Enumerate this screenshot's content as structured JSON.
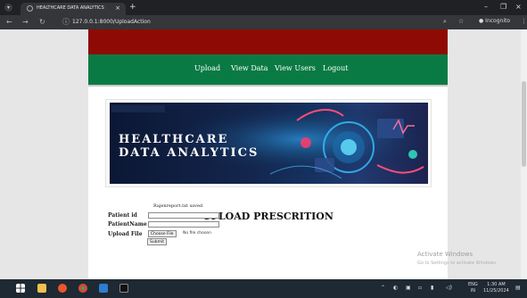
{
  "browser": {
    "tab_title": "HEALTHCARE DATA ANALYTICS",
    "url": "127.0.0.1:8000/UploadAction",
    "profile_label": "Incognito",
    "icons": {
      "tab_dropdown": "chevron-down-icon",
      "favicon": "globe-icon",
      "tab_close": "close-icon",
      "new_tab": "plus-icon",
      "minimize": "minimize-icon",
      "maximize": "maximize-icon",
      "close": "close-icon",
      "back": "back-arrow-icon",
      "forward": "forward-arrow-icon",
      "reload": "reload-icon",
      "site_info": "site-info-icon",
      "search": "search-icon",
      "bookmark": "star-icon",
      "menu": "kebab-menu-icon"
    }
  },
  "nav": {
    "links": [
      {
        "label": "Upload"
      },
      {
        "label": "View Data"
      },
      {
        "label": "View Users"
      },
      {
        "label": "Logout"
      }
    ]
  },
  "banner": {
    "line1": "HEALTHCARE",
    "line2": "DATA ANALYTICS"
  },
  "main": {
    "heading": "UPLOAD PRESCRITION",
    "status_message": "Rajenreport.txt saved",
    "form": {
      "patient_id_label": "Patient id",
      "patient_id_value": "",
      "patient_name_label": "PatientName",
      "patient_name_value": "",
      "upload_file_label": "Upload File",
      "choose_file_label": "Choose File",
      "no_file_text": "No file chosen",
      "submit_label": "Submit"
    }
  },
  "watermark": {
    "title": "Activate Windows",
    "subtitle": "Go to Settings to activate Windows."
  },
  "taskbar": {
    "lang_line1": "ENG",
    "lang_line2": "IN",
    "time": "1:30 AM",
    "date": "11/25/2024"
  },
  "colors": {
    "top_band": "#8e0b05",
    "nav_band": "#0a7a44",
    "browser_frame": "#202124"
  }
}
